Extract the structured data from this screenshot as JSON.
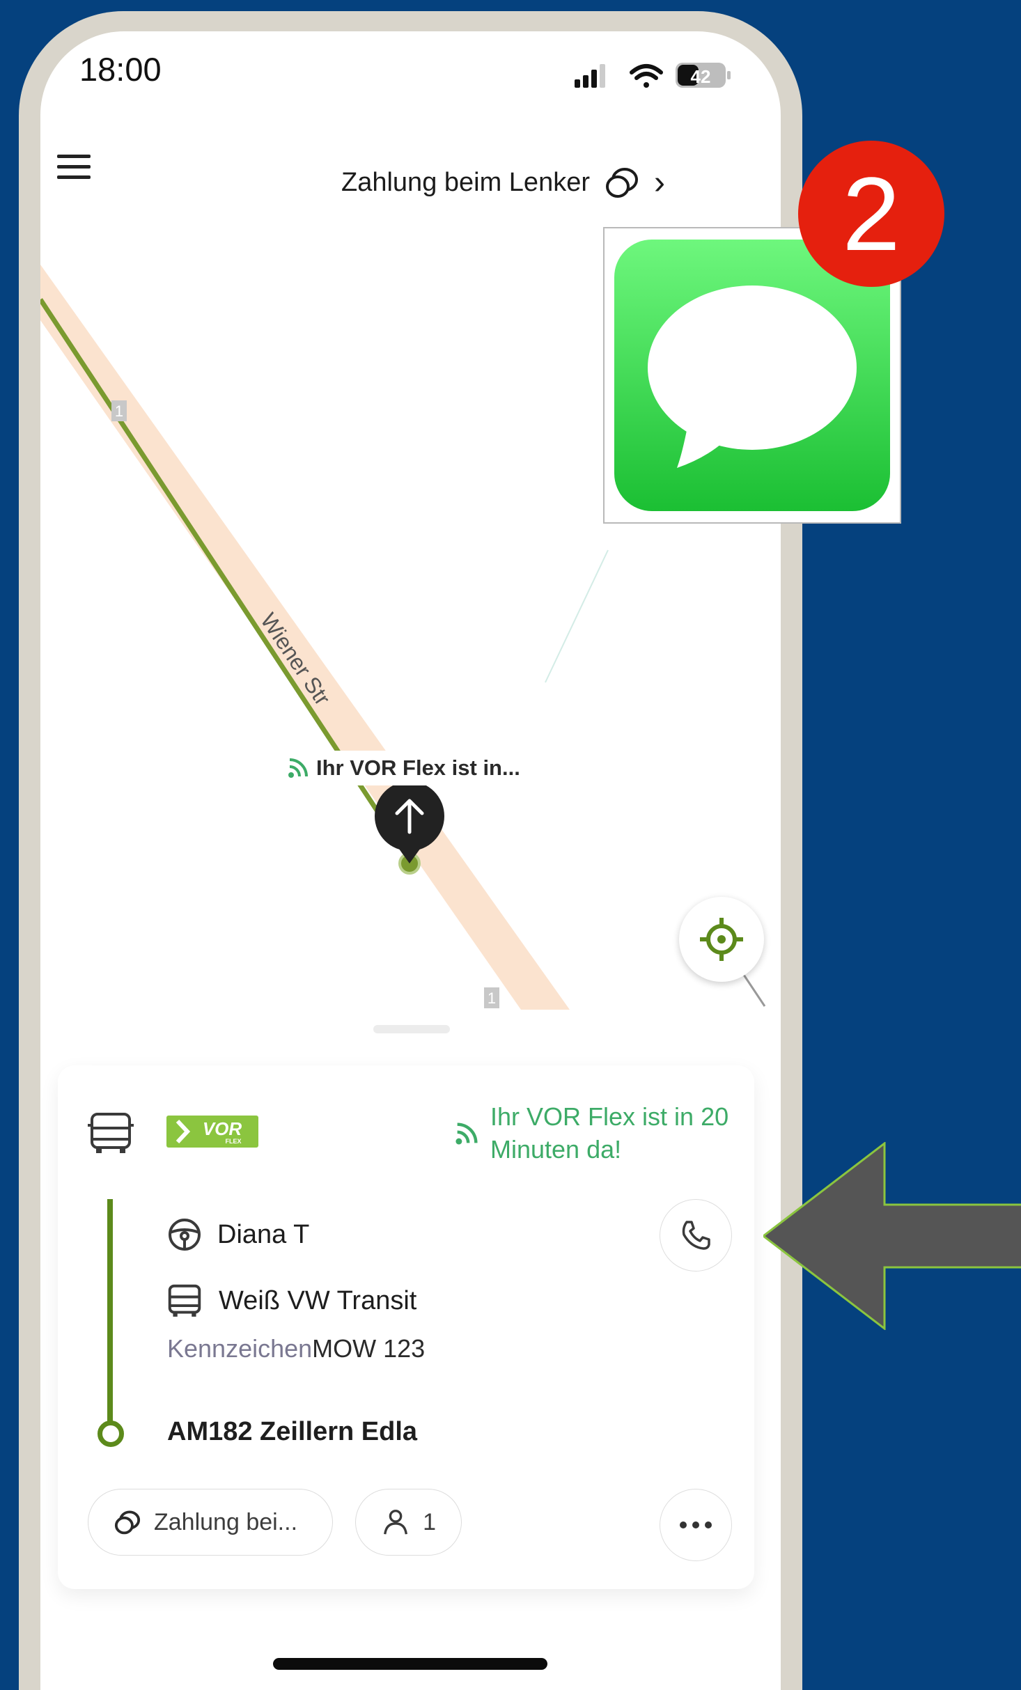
{
  "status_bar": {
    "time": "18:00",
    "battery": "42"
  },
  "header": {
    "payment_label": "Zahlung beim Lenker",
    "chevron": "›",
    "menu_icon": "menu-icon",
    "coins_icon": "coins-icon"
  },
  "map": {
    "street_name": "Wiener Str",
    "route_badge": "1",
    "vehicle_label": "Ihr VOR Flex ist in..."
  },
  "sheet": {
    "logo_text": "VOR",
    "logo_sub": "FLEX",
    "eta": "Ihr VOR Flex ist in 20 Minuten da!",
    "driver": "Diana T",
    "vehicle": "Weiß VW Transit",
    "plate_label": "Kennzeichen",
    "plate_value": "MOW 123",
    "destination": "AM182 Zeillern Edla",
    "payment_chip": "Zahlung bei...",
    "passengers": "1"
  },
  "overlay": {
    "badge_number": "2",
    "app_icon": "messages-app-icon"
  },
  "colors": {
    "background": "#05417e",
    "brand_green": "#8bc53f",
    "route_green": "#5c8a1b",
    "eta_green": "#3dab67",
    "badge_red": "#e5200e",
    "arrow_fill": "#555555",
    "arrow_outline": "#8bc53f"
  }
}
